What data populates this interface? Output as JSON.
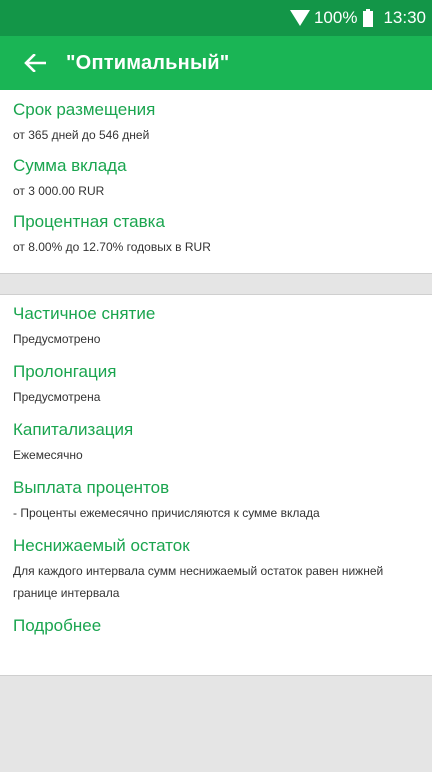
{
  "status_bar": {
    "battery": "100%",
    "time": "13:30"
  },
  "app_bar": {
    "title": "\"Оптимальный\""
  },
  "section1": {
    "items": [
      {
        "title": "Срок размещения",
        "value": "от 365 дней до 546 дней"
      },
      {
        "title": "Сумма вклада",
        "value": "от 3 000.00 RUR"
      },
      {
        "title": "Процентная ставка",
        "value": "от 8.00% до 12.70% годовых в RUR"
      }
    ]
  },
  "section2": {
    "items": [
      {
        "title": "Частичное снятие",
        "value": "Предусмотрено"
      },
      {
        "title": "Пролонгация",
        "value": "Предусмотрена"
      },
      {
        "title": "Капитализация",
        "value": "Ежемесячно"
      },
      {
        "title": "Выплата процентов",
        "value": "- Проценты ежемесячно причисляются к сумме вклада"
      },
      {
        "title": "Неснижаемый остаток",
        "value": "Для каждого интервала сумм неснижаемый остаток равен нижней границе интервала"
      }
    ],
    "more_link": "Подробнее"
  },
  "colors": {
    "status_bar": "#139648",
    "app_bar": "#1ab555",
    "accent_text": "#1aa54f",
    "background": "#e5e5e5"
  }
}
